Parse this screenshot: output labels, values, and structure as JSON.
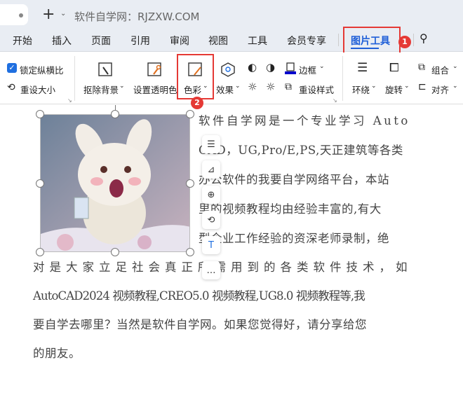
{
  "window": {
    "title": "软件自学网：RJZXW.COM"
  },
  "menu": [
    "开始",
    "插入",
    "页面",
    "引用",
    "审阅",
    "视图",
    "工具",
    "会员专享",
    "图片工具"
  ],
  "badges": [
    "1",
    "2"
  ],
  "ribbon": {
    "lock_ratio": "锁定纵横比",
    "reset_size": "重设大小",
    "remove_bg": "抠除背景",
    "set_transparent": "设置透明色",
    "color": "色彩",
    "effects": "效果",
    "border": "边框",
    "reset_style": "重设样式",
    "wrap": "环绕",
    "rotate": "旋转",
    "group": "组合",
    "align": "对齐"
  },
  "accent": "#1f5fd8",
  "document": {
    "lines": [
      "软件自学网是一个专业学习 Auto",
      "CAD，UG,Pro/E,PS,天正建筑等各类",
      "办公软件的我要自学网络平台，本站",
      "里的视频教程均由经验丰富的,有大",
      "型企业工作经验的资深老师录制，绝",
      "对是大家立足社会真正所需用到的各类软件技术，如",
      "AutoCAD2024 视频教程,CREO5.0 视频教程,UG8.0 视频教程等,我",
      "要自学去哪里？当然是软件自学网。如果您觉得好，请分享给您",
      "的朋友。"
    ]
  }
}
